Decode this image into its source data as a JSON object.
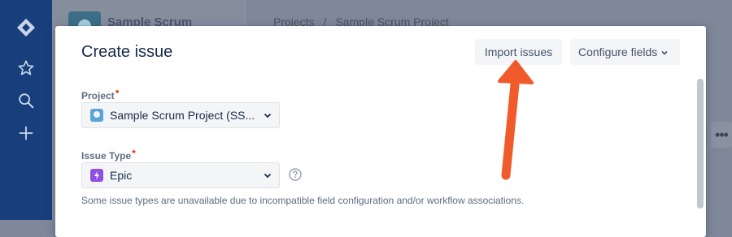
{
  "global_nav": {
    "icons": [
      "jira-logo-icon",
      "star-icon",
      "search-icon",
      "plus-icon"
    ]
  },
  "background": {
    "project_name": "Sample Scrum",
    "breadcrumb": {
      "items": [
        "Projects",
        "Sample Scrum Project"
      ],
      "separator": "/"
    },
    "more_label": "•••"
  },
  "modal": {
    "title": "Create issue",
    "import_button": "Import issues",
    "configure_button": "Configure fields",
    "project": {
      "label": "Project",
      "required_mark": "*",
      "value": "Sample Scrum Project (SS..."
    },
    "issue_type": {
      "label": "Issue Type",
      "required_mark": "*",
      "value": "Epic"
    },
    "helper_text": "Some issue types are unavailable due to incompatible field configuration and/or workflow associations."
  },
  "colors": {
    "accent_arrow": "#f15a2b",
    "nav_blue": "#173f7c",
    "required": "#de350b",
    "epic": "#904ee2"
  }
}
